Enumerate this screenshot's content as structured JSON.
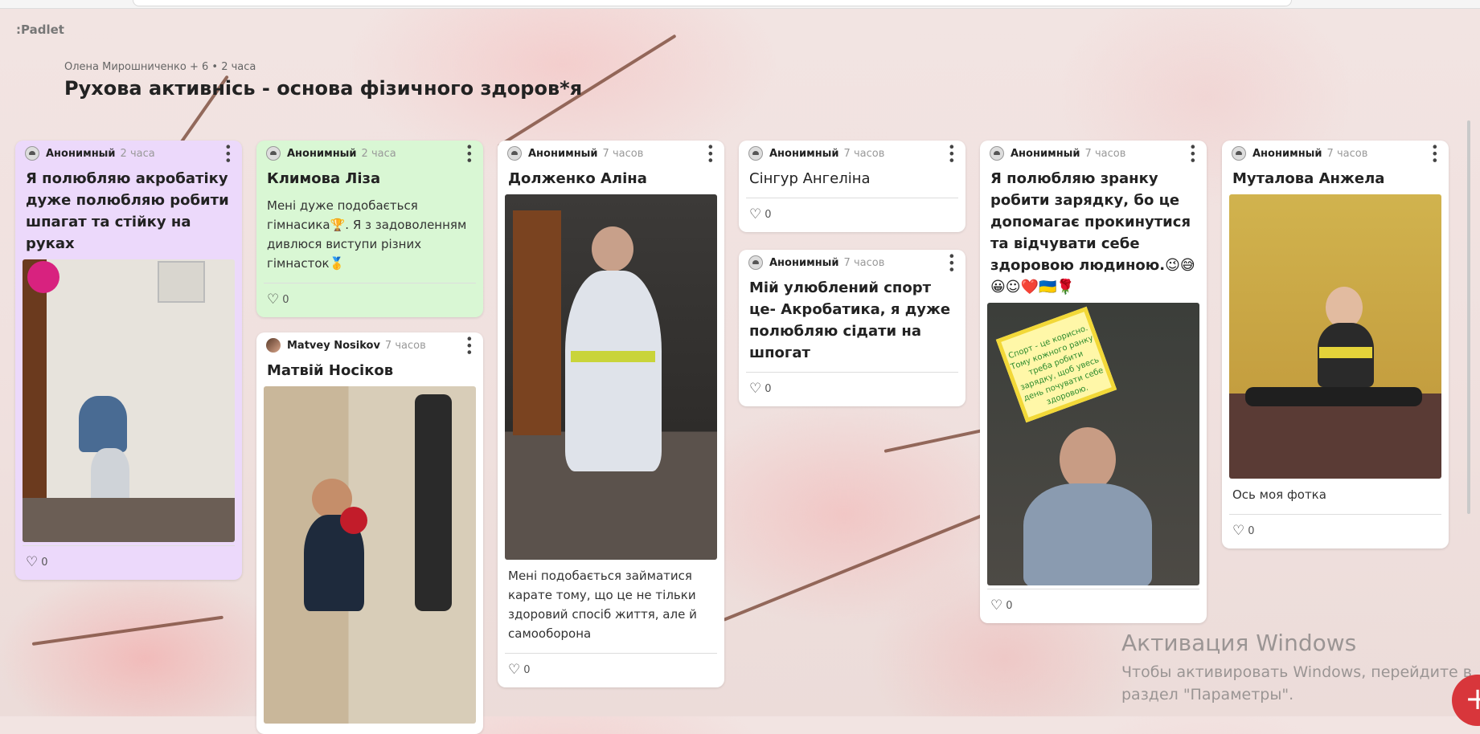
{
  "app": {
    "brand": ":Padlet"
  },
  "board": {
    "meta": "Олена Мирошниченко + 6 • 2 часа",
    "title": "Рухова активнісь - основа фізичного здоров*я"
  },
  "posts": [
    {
      "author": "Анонимный",
      "time": "2 часа",
      "title": "Я полюбляю акробатіку дуже полюбляю робити шпагат та стійку на руках",
      "likes": "0",
      "color": "#ecd9fb"
    },
    {
      "author": "Анонимный",
      "time": "2 часа",
      "title": "Климова Ліза",
      "body": "Мені дуже подобається гімнасика🏆. Я з задоволенням дивлюся виступи різних гімнасток🥇",
      "likes": "0",
      "color": "#d9f7d4"
    },
    {
      "author": "Matvey Nosikov",
      "time": "7 часов",
      "title": "Матвій Носіков"
    },
    {
      "author": "Анонимный",
      "time": "7 часов",
      "title": "Долженко Аліна",
      "body": "Мені подобається займатися карате тому, що це не тільки здоровий спосіб життя, але й самооборона",
      "likes": "0"
    },
    {
      "author": "Анонимный",
      "time": "7 часов",
      "title": "Сінгур Ангеліна",
      "likes": "0"
    },
    {
      "author": "Анонимный",
      "time": "7 часов",
      "title": "Мій улюблений спорт це- Акробатика, я дуже полюбляю сідати на шпогат",
      "likes": "0"
    },
    {
      "author": "Анонимный",
      "time": "7 часов",
      "title": "Я полюбляю зранку робити зарядку, бо це допомагає прокинутися та відчувати себе здоровою людиною.😉😅😀☺❤️🇺🇦🌹",
      "likes": "0",
      "note": "Спорт - це корисно. Тому кожного ранку треба робити зарядку, щоб увесь день почувати себе здоровою."
    },
    {
      "author": "Анонимный",
      "time": "7 часов",
      "title": "Муталова Анжела",
      "body": "Ось моя фотка",
      "likes": "0"
    }
  ],
  "activation": {
    "title": "Активация Windows",
    "line1": "Чтобы активировать Windows, перейдите в",
    "line2": "раздел \"Параметры\"."
  },
  "fab": {
    "label": "+"
  },
  "icons": {
    "menu": "more-vertical-icon",
    "like": "heart-icon",
    "avatar": "user-avatar-icon"
  }
}
